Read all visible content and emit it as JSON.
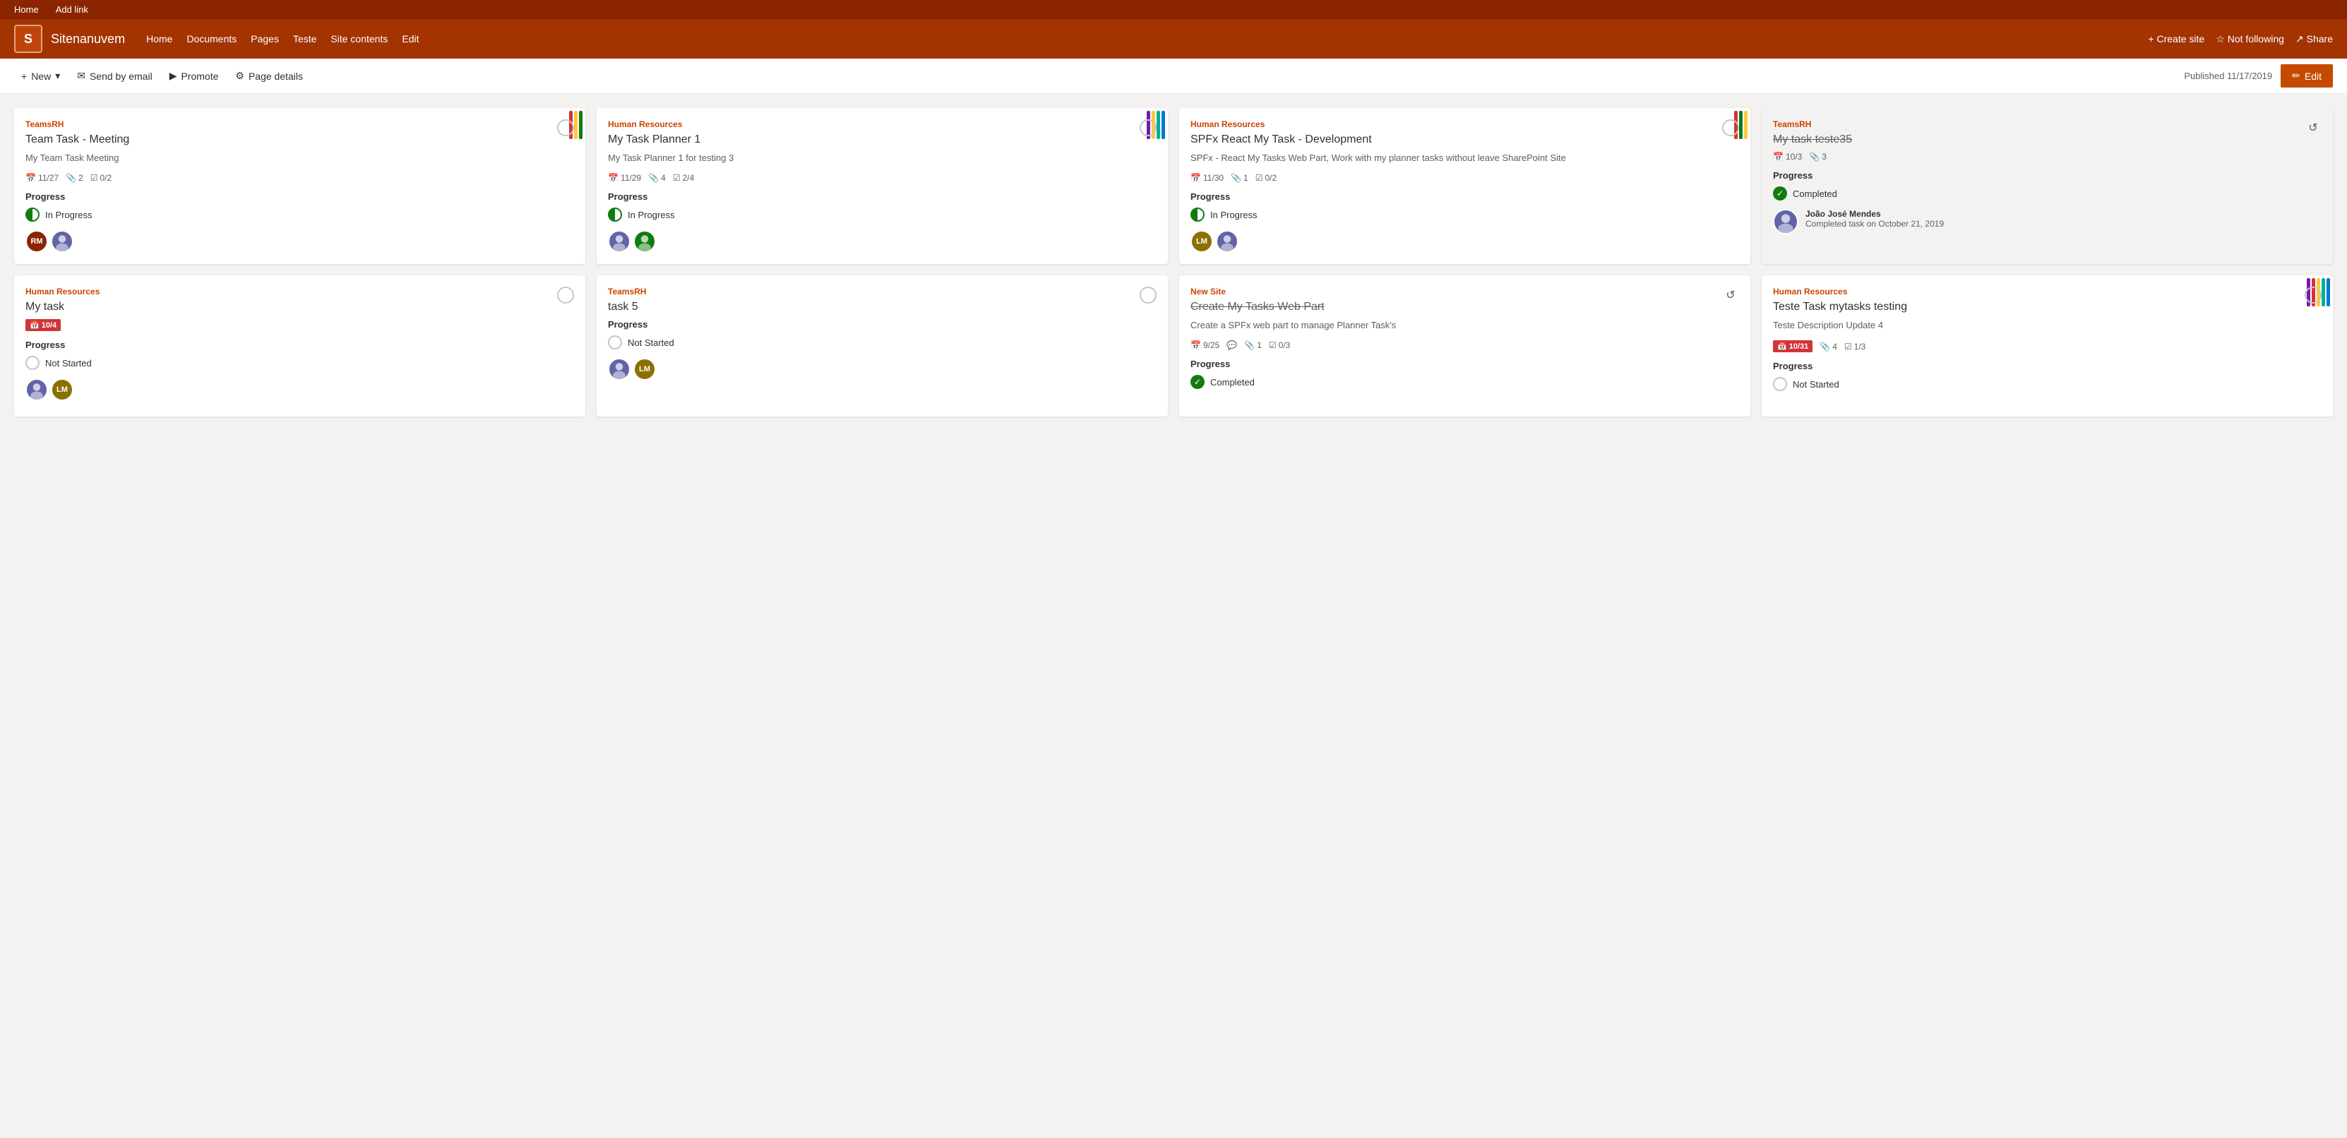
{
  "topNav": {
    "home": "Home",
    "addLink": "Add link"
  },
  "siteHeader": {
    "logoLetter": "S",
    "siteName": "Sitenanuvem",
    "navItems": [
      "Home",
      "Documents",
      "Pages",
      "Teste",
      "Site contents",
      "Edit"
    ],
    "createSite": "+ Create site",
    "notFollowing": "Not following",
    "share": "Share"
  },
  "toolbar": {
    "new": "New",
    "sendByEmail": "Send by email",
    "promote": "Promote",
    "pageDetails": "Page details",
    "published": "Published 11/17/2019",
    "edit": "Edit"
  },
  "cards": [
    {
      "id": "card1",
      "group": "TeamsRH",
      "title": "Team Task - Meeting",
      "titleStrike": false,
      "description": "My Team Task Meeting",
      "date": "11/27",
      "dateOverdue": false,
      "clips": "2",
      "checks": "0/2",
      "progress": "In Progress",
      "progressType": "inprogress",
      "hasCheck": true,
      "hasRefresh": false,
      "avatars": [
        {
          "initials": "RM",
          "color": "#8b2500"
        },
        {
          "initials": "",
          "color": "#6264a7",
          "image": true
        }
      ],
      "colorBars": [
        "#d13438",
        "#ffc83d",
        "#107c10"
      ],
      "completedUser": null
    },
    {
      "id": "card2",
      "group": "Human Resources",
      "title": "My Task Planner 1",
      "titleStrike": false,
      "description": "My Task Planner 1 for testing 3",
      "date": "11/29",
      "dateOverdue": false,
      "clips": "4",
      "checks": "2/4",
      "progress": "In Progress",
      "progressType": "inprogress",
      "hasCheck": true,
      "hasRefresh": false,
      "avatars": [
        {
          "initials": "",
          "color": "#6264a7",
          "image": true
        },
        {
          "initials": "",
          "color": "#107c10",
          "image": true
        }
      ],
      "colorBars": [
        "#7719aa",
        "#ffc83d",
        "#00b294",
        "#0078d4"
      ],
      "completedUser": null
    },
    {
      "id": "card3",
      "group": "Human Resources",
      "title": "SPFx React My Task - Development",
      "titleStrike": false,
      "description": "SPFx - React My Tasks Web Part, Work with my planner tasks without leave SharePoint Site",
      "date": "11/30",
      "dateOverdue": false,
      "clips": "1",
      "checks": "0/2",
      "progress": "In Progress",
      "progressType": "inprogress",
      "hasCheck": true,
      "hasRefresh": false,
      "avatars": [
        {
          "initials": "LM",
          "color": "#8b7000"
        },
        {
          "initials": "",
          "color": "#6264a7",
          "image": true
        }
      ],
      "colorBars": [
        "#d13438",
        "#107c10",
        "#ffc83d"
      ],
      "completedUser": null
    },
    {
      "id": "card4",
      "group": "TeamsRH",
      "title": "My task teste35",
      "titleStrike": true,
      "description": "",
      "date": "10/3",
      "dateOverdue": false,
      "clips": "3",
      "checks": "",
      "progress": "Completed",
      "progressType": "completed",
      "hasCheck": false,
      "hasRefresh": true,
      "greyBg": true,
      "avatars": [],
      "colorBars": [],
      "completedUser": {
        "name": "João José Mendes",
        "date": "Completed task on October 21, 2019"
      }
    },
    {
      "id": "card5",
      "group": "Human Resources",
      "title": "My task",
      "titleStrike": false,
      "description": "",
      "date": "10/4",
      "dateOverdue": true,
      "clips": "",
      "checks": "",
      "progress": "Not Started",
      "progressType": "notstarted",
      "hasCheck": true,
      "hasRefresh": false,
      "avatars": [
        {
          "initials": "",
          "color": "#6264a7",
          "image": true
        },
        {
          "initials": "LM",
          "color": "#8b7000"
        }
      ],
      "colorBars": [],
      "completedUser": null
    },
    {
      "id": "card6",
      "group": "TeamsRH",
      "title": "task 5",
      "titleStrike": false,
      "description": "",
      "date": "",
      "dateOverdue": false,
      "clips": "",
      "checks": "",
      "progress": "Not Started",
      "progressType": "notstarted",
      "hasCheck": true,
      "hasRefresh": false,
      "avatars": [
        {
          "initials": "",
          "color": "#6264a7",
          "image": true
        },
        {
          "initials": "LM",
          "color": "#8b7000"
        }
      ],
      "colorBars": [],
      "completedUser": null
    },
    {
      "id": "card7",
      "group": "New Site",
      "title": "Create My Tasks Web Part",
      "titleStrike": true,
      "description": "Create a SPFx web part to manage Planner Task's",
      "date": "9/25",
      "dateOverdue": false,
      "clips": "1",
      "checks": "0/3",
      "progress": "Completed",
      "progressType": "completed",
      "hasCheck": false,
      "hasRefresh": true,
      "greyBg": false,
      "avatars": [],
      "colorBars": [],
      "completedUser": null,
      "hasChat": true
    },
    {
      "id": "card8",
      "group": "Human Resources",
      "title": "Teste Task mytasks testing",
      "titleStrike": false,
      "description": "Teste Description Update 4",
      "date": "10/31",
      "dateOverdue": true,
      "clips": "4",
      "checks": "1/3",
      "progress": "Not Started",
      "progressType": "notstarted",
      "hasCheck": true,
      "hasRefresh": false,
      "avatars": [],
      "colorBars": [
        "#7719aa",
        "#d13438",
        "#ffc83d",
        "#00b294",
        "#0078d4"
      ],
      "completedUser": null
    }
  ]
}
